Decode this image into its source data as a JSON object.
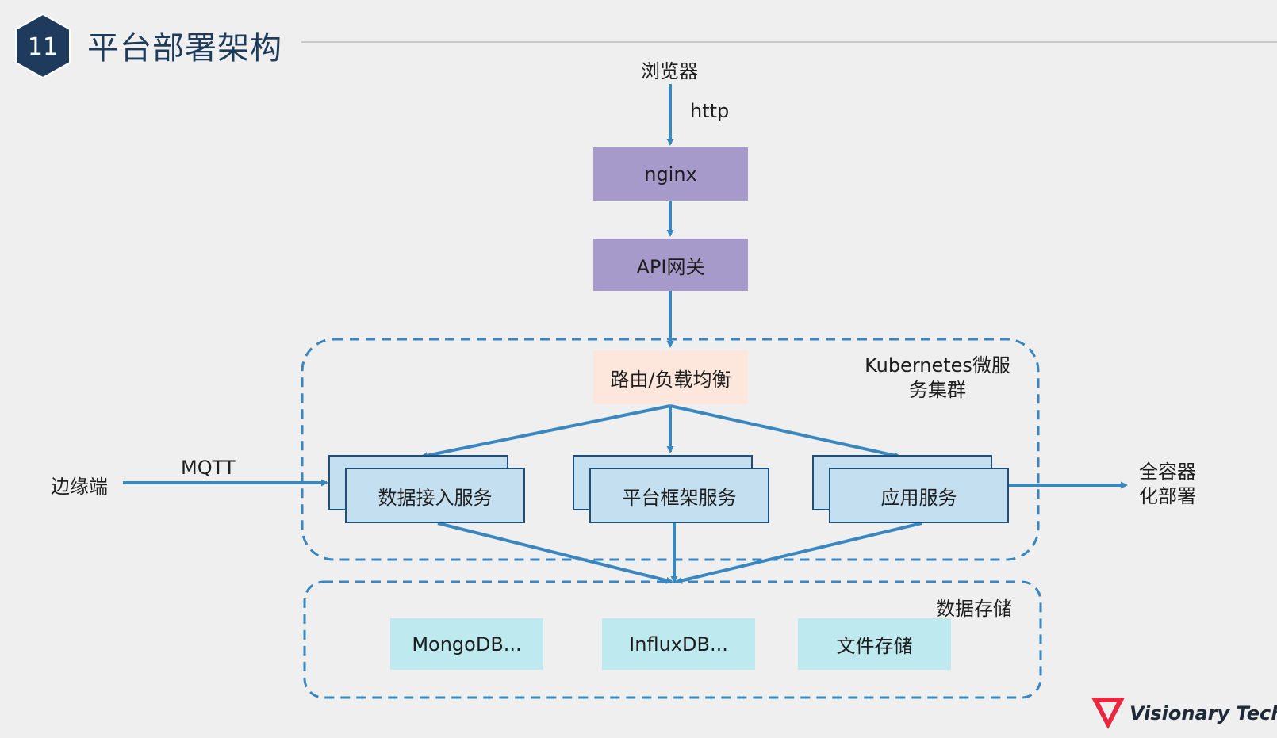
{
  "slide": {
    "number": "11",
    "title": "平台部署架构"
  },
  "diagram": {
    "browser": "浏览器",
    "http_label": "http",
    "nginx": "nginx",
    "api_gateway": "API网关",
    "router_lb": "路由/负载均衡",
    "k8s_cluster_label": "Kubernetes微服\n务集群",
    "edge": "边缘端",
    "mqtt_label": "MQTT",
    "services": [
      "数据接入服务",
      "平台框架服务",
      "应用服务"
    ],
    "container_label": "全容器\n化部署",
    "storage_label": "数据存储",
    "stores": [
      "MongoDB...",
      "InfluxDB...",
      "文件存储"
    ]
  },
  "brand": {
    "name": "Visionary Tech",
    "accent_color": "#e8283f"
  },
  "colors": {
    "arrow": "#3a86bf",
    "dashed_border": "#3a86bf",
    "badge": "#1e3a5c"
  }
}
